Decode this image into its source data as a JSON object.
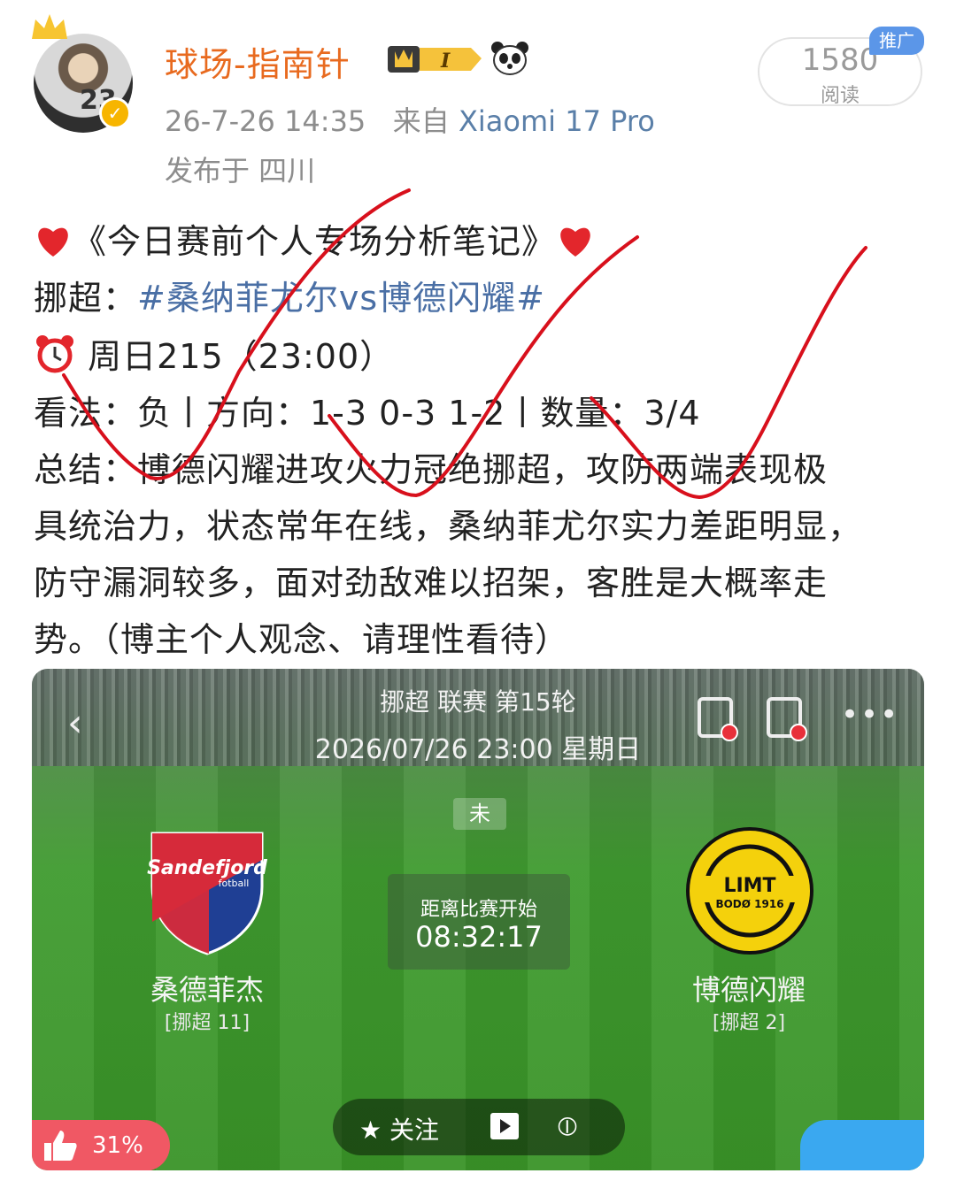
{
  "post": {
    "username": "球场-指南针",
    "level_badge": "I",
    "time": "26-7-26 14:35",
    "source_prefix": "来自",
    "device": "Xiaomi 17 Pro",
    "location": "发布于 四川",
    "views_count": "1580",
    "views_label": "阅读",
    "promo_tag": "推广"
  },
  "body": {
    "line1_text": "《今日赛前个人专场分析笔记》",
    "line2_label": "挪超：",
    "line2_hashtag": "#桑纳菲尤尔vs博德闪耀#",
    "line3_text": "周日215（23:00）",
    "line4_text": "看法：负丨方向：1-3 0-3 1-2丨数量：3/4",
    "line5_text": "总结：博德闪耀进攻火力冠绝挪超，攻防两端表现极",
    "line6_text": "具统治力，状态常年在线，桑纳菲尤尔实力差距明显，",
    "line7_text": "防守漏洞较多，面对劲敌难以招架，客胜是大概率走",
    "line8_text": "势。（博主个人观念、请理性看待）"
  },
  "match_card": {
    "title": "挪超 联赛 第15轮",
    "datetime": "2026/07/26 23:00 星期日",
    "status": "未",
    "countdown_label": "距离比赛开始",
    "countdown_time": "08:32:17",
    "home_logo_text": "Sandefjord",
    "home_logo_subtext": "fotball",
    "home_team": "桑德菲杰",
    "home_league": "[挪超 11]",
    "away_logo_text": "LIMT",
    "away_logo_subtext": "BODØ 1916",
    "away_team": "博德闪耀",
    "away_league": "[挪超 2]",
    "follow_label": "关注",
    "like_percent": "31%"
  },
  "colors": {
    "username": "#e86a1f",
    "hashtag": "#4a6fa5",
    "device": "#5a7fa8",
    "check_marks": "#d8101c",
    "promo": "#5b96e8"
  },
  "icons": [
    "crown-icon",
    "verified-icon",
    "level-badge-icon",
    "panda-icon",
    "heart-icon",
    "alarm-clock-icon",
    "back-arrow-icon",
    "pitch-icon",
    "stadium-icon",
    "more-icon",
    "star-icon",
    "play-icon",
    "split-icon",
    "thumbs-up-icon"
  ]
}
